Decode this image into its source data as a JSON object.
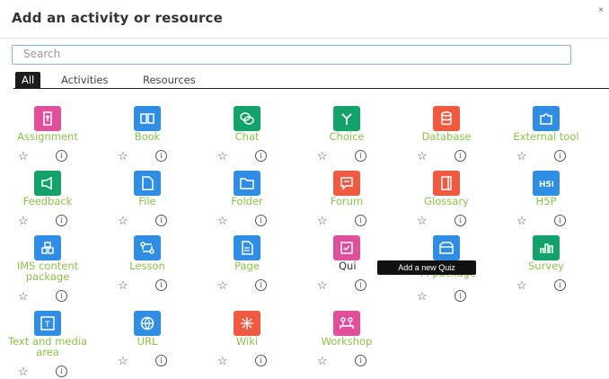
{
  "dialog": {
    "title": "Add an activity or resource",
    "close_glyph": "×"
  },
  "search": {
    "placeholder": "Search",
    "value": ""
  },
  "tabs": [
    {
      "label": "All",
      "active": true
    },
    {
      "label": "Activities",
      "active": false
    },
    {
      "label": "Resources",
      "active": false
    }
  ],
  "tooltip": "Add a new Quiz",
  "items": [
    {
      "label": "Assignment",
      "color": "#e04f9c",
      "icon": "assignment-icon"
    },
    {
      "label": "Book",
      "color": "#2f8de4",
      "icon": "book-icon"
    },
    {
      "label": "Chat",
      "color": "#13a36a",
      "icon": "chat-icon"
    },
    {
      "label": "Choice",
      "color": "#13a36a",
      "icon": "choice-icon"
    },
    {
      "label": "Database",
      "color": "#f05a40",
      "icon": "database-icon"
    },
    {
      "label": "External tool",
      "color": "#2f8de4",
      "icon": "puzzle-icon"
    },
    {
      "label": "Feedback",
      "color": "#13a36a",
      "icon": "megaphone-icon"
    },
    {
      "label": "File",
      "color": "#2f8de4",
      "icon": "file-icon"
    },
    {
      "label": "Folder",
      "color": "#2f8de4",
      "icon": "folder-icon"
    },
    {
      "label": "Forum",
      "color": "#f05a40",
      "icon": "forum-icon"
    },
    {
      "label": "Glossary",
      "color": "#f05a40",
      "icon": "glossary-icon"
    },
    {
      "label": "H5P",
      "color": "#2f8de4",
      "icon": "h5p-icon"
    },
    {
      "label": "IMS content package",
      "color": "#2f8de4",
      "icon": "package-icon"
    },
    {
      "label": "Lesson",
      "color": "#2f8de4",
      "icon": "lesson-icon"
    },
    {
      "label": "Page",
      "color": "#2f8de4",
      "icon": "page-icon"
    },
    {
      "label": "Qui",
      "color": "#e04f9c",
      "icon": "quiz-icon"
    },
    {
      "label": "M package",
      "color": "#2f8de4",
      "icon": "scorm-icon"
    },
    {
      "label": "Survey",
      "color": "#13a36a",
      "icon": "survey-icon"
    },
    {
      "label": "Text and media area",
      "color": "#2f8de4",
      "icon": "text-media-icon"
    },
    {
      "label": "URL",
      "color": "#2f8de4",
      "icon": "url-icon"
    },
    {
      "label": "Wiki",
      "color": "#f05a40",
      "icon": "wiki-icon"
    },
    {
      "label": "Workshop",
      "color": "#e04f9c",
      "icon": "workshop-icon"
    }
  ],
  "item_actions": {
    "star_glyph": "☆",
    "info_glyph": "i"
  }
}
